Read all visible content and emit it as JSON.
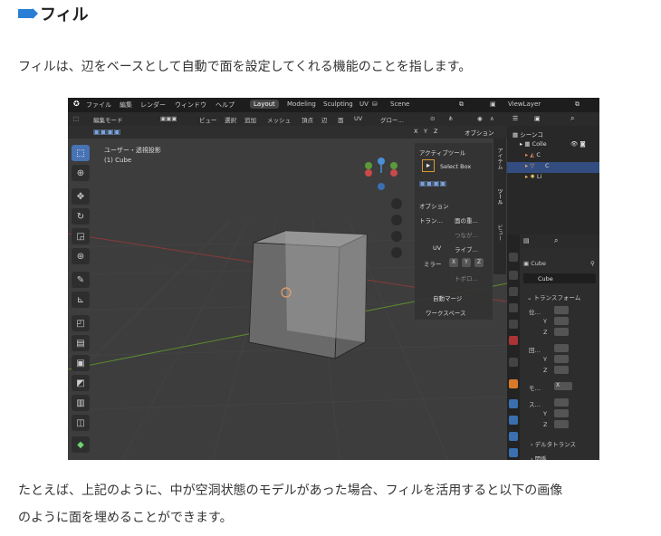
{
  "heading": "フィル",
  "intro": "フィルは、辺をベースとして自動で面を設定してくれる機能のことを指します。",
  "body_line1": "たとえば、上記のように、中が空洞状態のモデルがあった場合、フィルを活用すると以下の画像",
  "body_line2": "のように面を埋めることができます。",
  "blender": {
    "menu": [
      "ファイル",
      "編集",
      "レンダー",
      "ウィンドウ",
      "ヘルプ"
    ],
    "workspaces": [
      "Layout",
      "Modeling",
      "Sculpting",
      "UV"
    ],
    "scene": "Scene",
    "view_layer": "ViewLayer",
    "mode": "編集モード",
    "view_menu": [
      "ビュー",
      "選択",
      "追加",
      "メッシュ",
      "頂点",
      "辺",
      "面",
      "UV"
    ],
    "transform": "グロー…",
    "options_btn": "オプション",
    "viewport_title": "ユーザー・透視投影",
    "object_label": "(1) Cube",
    "npanel": {
      "active_tool": "アクティブツール",
      "select_box": "Select Box",
      "options": "オプション",
      "trans": "トラン…",
      "face_center": "面の重…",
      "connected": "つなが…",
      "uv": "UV",
      "live": "ライブ…",
      "mirror": "ミラー",
      "x": "X",
      "y": "Y",
      "z": "Z",
      "topo": "トポロ…",
      "auto_merge": "自動マージ",
      "workspace": "ワークスペース"
    },
    "side_tabs": [
      "アイテム",
      "ツール",
      "ビュー"
    ],
    "outliner": {
      "scene_collection": "シーンコ",
      "collection": "Colle",
      "camera": "C",
      "cube": "C",
      "light": "Li"
    },
    "props": {
      "object_name": "Cube",
      "mesh_name": "Cube",
      "transform": "トランスフォーム",
      "location": "位…",
      "rotation": "回…",
      "mode": "モ…",
      "mode_value": "X",
      "scale": "ス…",
      "delta": "デルタトランス",
      "relations": "関係",
      "x": "X",
      "y": "Y",
      "z": "Z"
    },
    "accent": "#4772b3"
  }
}
